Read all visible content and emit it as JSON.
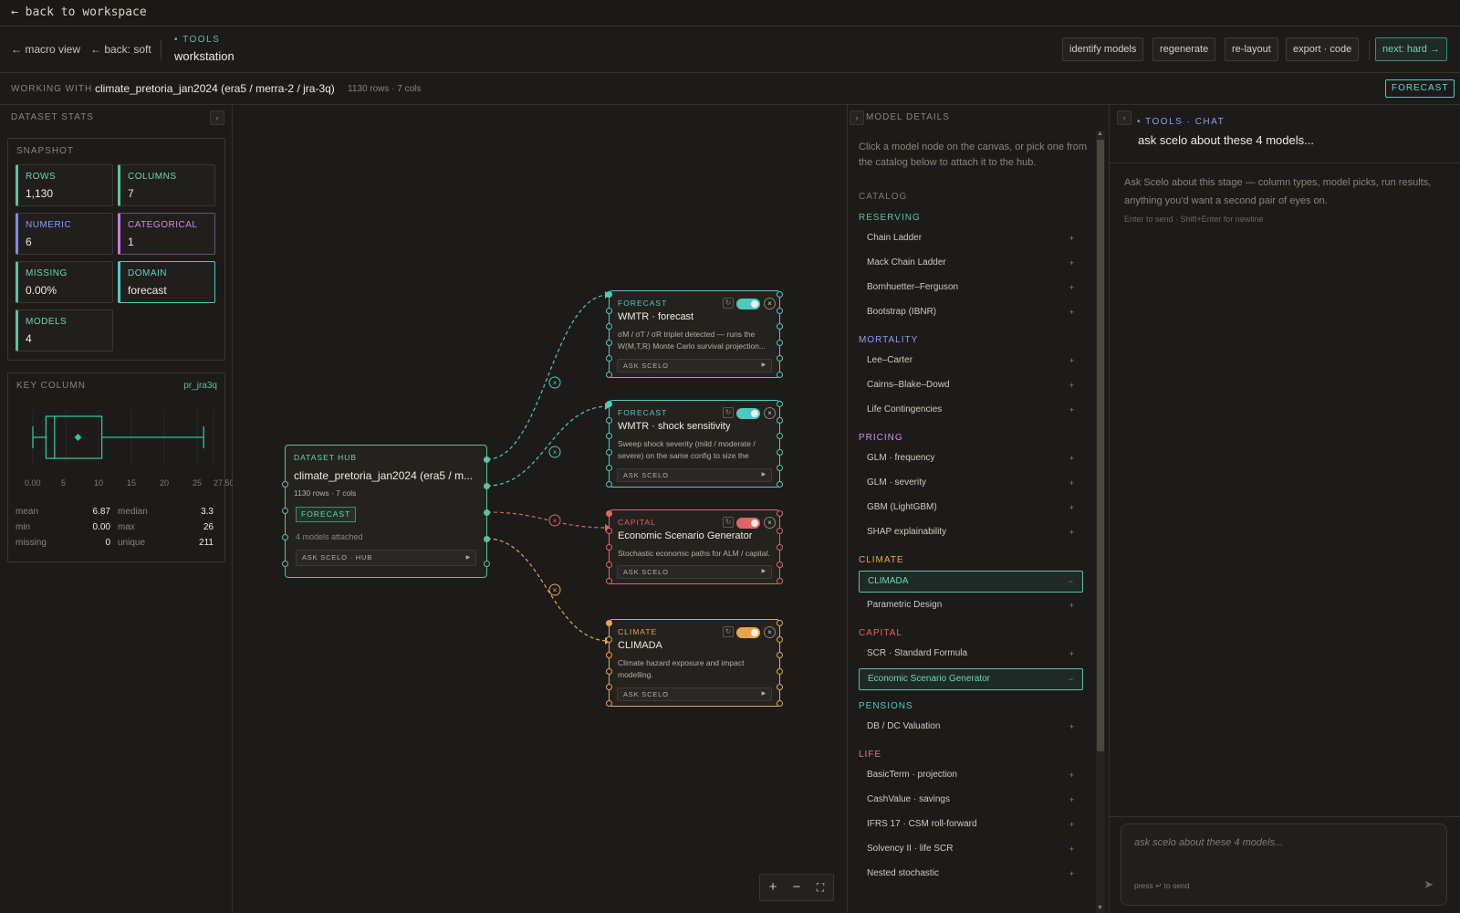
{
  "topbar": {
    "back": "← back to workspace"
  },
  "header": {
    "nav": [
      "← macro view",
      "← back: soft"
    ],
    "crumb_small": "• TOOLS",
    "crumb_title": "workstation",
    "buttons": [
      "identify models",
      "regenerate",
      "re-layout",
      "export · code"
    ],
    "next": "next: hard →"
  },
  "working": {
    "label": "WORKING WITH",
    "name": "climate_pretoria_jan2024 (era5 / merra-2 / jra-3q)",
    "meta": "1130 rows · 7 cols",
    "badge": "FORECAST"
  },
  "left": {
    "title": "DATASET STATS",
    "snapshot_title": "SNAPSHOT",
    "stats": [
      {
        "k": "ROWS",
        "v": "1,130"
      },
      {
        "k": "COLUMNS",
        "v": "7"
      },
      {
        "k": "NUMERIC",
        "v": "6"
      },
      {
        "k": "CATEGORICAL",
        "v": "1"
      },
      {
        "k": "MISSING",
        "v": "0.00%"
      },
      {
        "k": "DOMAIN",
        "v": "forecast"
      },
      {
        "k": "MODELS",
        "v": "4"
      }
    ],
    "key_title": "KEY COLUMN",
    "key_name": "pr_jra3q",
    "boxplot": {
      "min": 0,
      "q1": 2,
      "median": 3.3,
      "mean": 6.87,
      "q3": 10.5,
      "max": 26,
      "axis_max": 27.5,
      "ticks": [
        "0.00",
        "5",
        "10",
        "15",
        "20",
        "25",
        "27.50"
      ]
    },
    "summary": [
      {
        "k": "mean",
        "v": "6.87"
      },
      {
        "k": "median",
        "v": "3.3"
      },
      {
        "k": "min",
        "v": "0.00"
      },
      {
        "k": "max",
        "v": "26"
      },
      {
        "k": "missing",
        "v": "0"
      },
      {
        "k": "unique",
        "v": "211"
      }
    ]
  },
  "canvas": {
    "hub": {
      "tag": "DATASET HUB",
      "title": "climate_pretoria_jan2024 (era5 / m...",
      "meta": "1130 rows · 7 cols",
      "badge": "FORECAST",
      "attached": "4 models attached",
      "ask": "ASK SCELO · HUB"
    },
    "nodes": [
      {
        "tag": "FORECAST",
        "title": "WMTR · forecast",
        "desc": "σM / σT / σR triplet detected — runs the W(M,T,R) Monte Carlo survival projection...",
        "ask": "ASK SCELO",
        "color": "#4ec9c0"
      },
      {
        "tag": "FORECAST",
        "title": "WMTR · shock sensitivity",
        "desc": "Sweep shock severity (mild / moderate / severe) on the same config to size the stres...",
        "ask": "ASK SCELO",
        "color": "#4ec9c0"
      },
      {
        "tag": "CAPITAL",
        "title": "Economic Scenario Generator",
        "desc": "Stochastic economic paths for ALM / capital.",
        "ask": "ASK SCELO",
        "color": "#e06464"
      },
      {
        "tag": "CLIMATE",
        "title": "CLIMADA",
        "desc": "Climate hazard exposure and impact modelling.",
        "ask": "ASK SCELO",
        "color": "#e8a64c"
      }
    ],
    "zoom": [
      "+",
      "−",
      "⛶"
    ]
  },
  "details": {
    "title": "MODEL DETAILS",
    "hint": "Click a model node on the canvas, or pick one from the catalog below to attach it to the hub.",
    "catalog": "CATALOG",
    "groups": [
      {
        "name": "RESERVING",
        "color": "#5fc0a0",
        "items": [
          "Chain Ladder",
          "Mack Chain Ladder",
          "Bornhuetter–Ferguson",
          "Bootstrap (IBNR)"
        ]
      },
      {
        "name": "MORTALITY",
        "color": "#8e9cf0",
        "items": [
          "Lee–Carter",
          "Cairns–Blake–Dowd",
          "Life Contingencies"
        ]
      },
      {
        "name": "PRICING",
        "color": "#cf8ce8",
        "items": [
          "GLM · frequency",
          "GLM · severity",
          "GBM (LightGBM)",
          "SHAP explainability"
        ]
      },
      {
        "name": "CLIMATE",
        "color": "#e8a64c",
        "items": [
          "CLIMADA",
          "Parametric Design"
        ]
      },
      {
        "name": "CAPITAL",
        "color": "#e06464",
        "items": [
          "SCR · Standard Formula",
          "Economic Scenario Generator"
        ]
      },
      {
        "name": "PENSIONS",
        "color": "#4ec9c0",
        "items": [
          "DB / DC Valuation"
        ]
      },
      {
        "name": "LIFE",
        "color": "#e8728f",
        "items": [
          "BasicTerm · projection",
          "CashValue · savings",
          "IFRS 17 · CSM roll-forward",
          "Solvency II · life SCR",
          "Nested stochastic"
        ]
      }
    ],
    "selected": [
      "CLIMADA",
      "Economic Scenario Generator"
    ]
  },
  "chat": {
    "tag": "• TOOLS · CHAT",
    "title": "ask scelo about these 4 models...",
    "body": "Ask Scelo about this stage — column types, model picks, run results, anything you'd want a second pair of eyes on.",
    "hint": "Enter to send · Shift+Enter for newline",
    "placeholder": "ask scelo about these 4 models...",
    "press": "press ↵ to send"
  }
}
